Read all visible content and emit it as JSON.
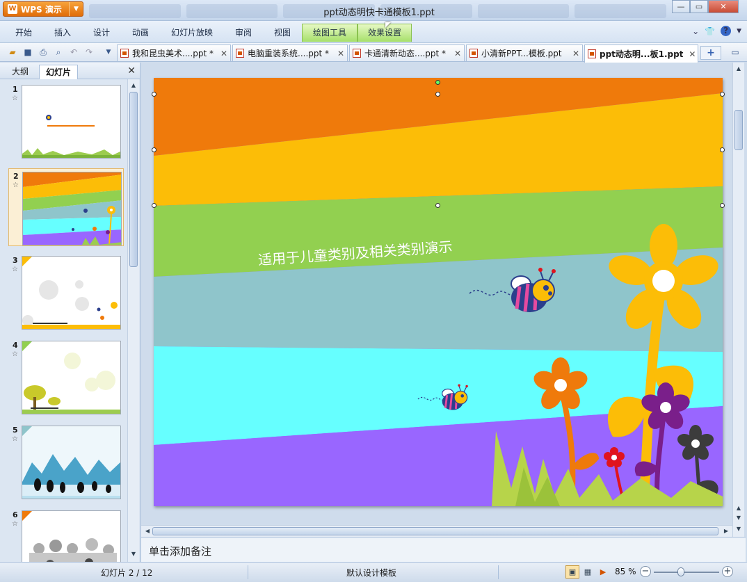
{
  "app": {
    "menu_label": "WPS 演示",
    "window_title": "ppt动态明快卡通模板1.ppt"
  },
  "ribbon": {
    "tabs": [
      "开始",
      "插入",
      "设计",
      "动画",
      "幻灯片放映",
      "审阅",
      "视图"
    ],
    "context_tabs": [
      "绘图工具",
      "效果设置"
    ]
  },
  "doc_tabs": [
    {
      "label": "我和昆虫美术....ppt *",
      "active": false
    },
    {
      "label": "电脑重装系统....ppt *",
      "active": false
    },
    {
      "label": "卡通清新动态....ppt *",
      "active": false
    },
    {
      "label": "小清新PPT...模板.ppt",
      "active": false
    },
    {
      "label": "ppt动态明...板1.ppt",
      "active": true
    }
  ],
  "left_panel": {
    "tabs": [
      "大纲",
      "幻灯片"
    ],
    "active_tab": "幻灯片",
    "slides": [
      {
        "number": "1"
      },
      {
        "number": "2"
      },
      {
        "number": "3"
      },
      {
        "number": "4"
      },
      {
        "number": "5"
      },
      {
        "number": "6"
      }
    ],
    "selected": 2
  },
  "slide": {
    "subtitle": "适用于儿童类别及相关类别演示"
  },
  "notes": {
    "placeholder": "单击添加备注"
  },
  "status": {
    "slide_indicator": "幻灯片 2 / 12",
    "template": "默认设计模板",
    "zoom": "85 %"
  },
  "colors": {
    "band_orange": "#ef7a0b",
    "band_amber": "#fcbd07",
    "band_green": "#92d050",
    "band_teal": "#8fc5cb",
    "band_cyan": "#66ffff",
    "band_purple": "#9966ff",
    "accent_green_tab": "#a6e06a"
  }
}
